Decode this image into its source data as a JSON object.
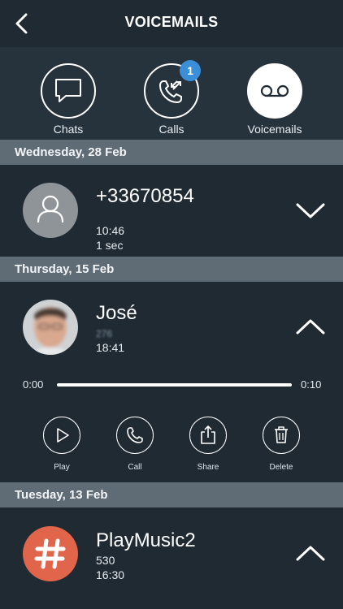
{
  "header": {
    "title": "VOICEMAILS"
  },
  "tabs": [
    {
      "label": "Chats"
    },
    {
      "label": "Calls",
      "badge": "1"
    },
    {
      "label": "Voicemails"
    }
  ],
  "sections": [
    {
      "date": "Wednesday, 28 Feb",
      "entries": [
        {
          "name": "+33670854",
          "time": "10:46",
          "duration": "1 sec",
          "avatar": "person-icon",
          "expanded": false
        }
      ]
    },
    {
      "date": "Thursday, 15 Feb",
      "entries": [
        {
          "name": "José",
          "number": "276",
          "time": "18:41",
          "avatar": "photo",
          "expanded": true,
          "player": {
            "current": "0:00",
            "total": "0:10"
          },
          "actions": [
            "Play",
            "Call",
            "Share",
            "Delete"
          ]
        }
      ]
    },
    {
      "date": "Tuesday, 13 Feb",
      "entries": [
        {
          "name": "PlayMusic2",
          "number": "530",
          "time": "16:30",
          "avatar": "hash-icon",
          "expanded": true
        }
      ]
    }
  ],
  "colors": {
    "background": "#1f2a33",
    "tab_bar": "#26323c",
    "date_header": "#5f6c76",
    "badge": "#3b8fd9",
    "hash_avatar": "#e0654a",
    "person_avatar": "#8f9499"
  }
}
